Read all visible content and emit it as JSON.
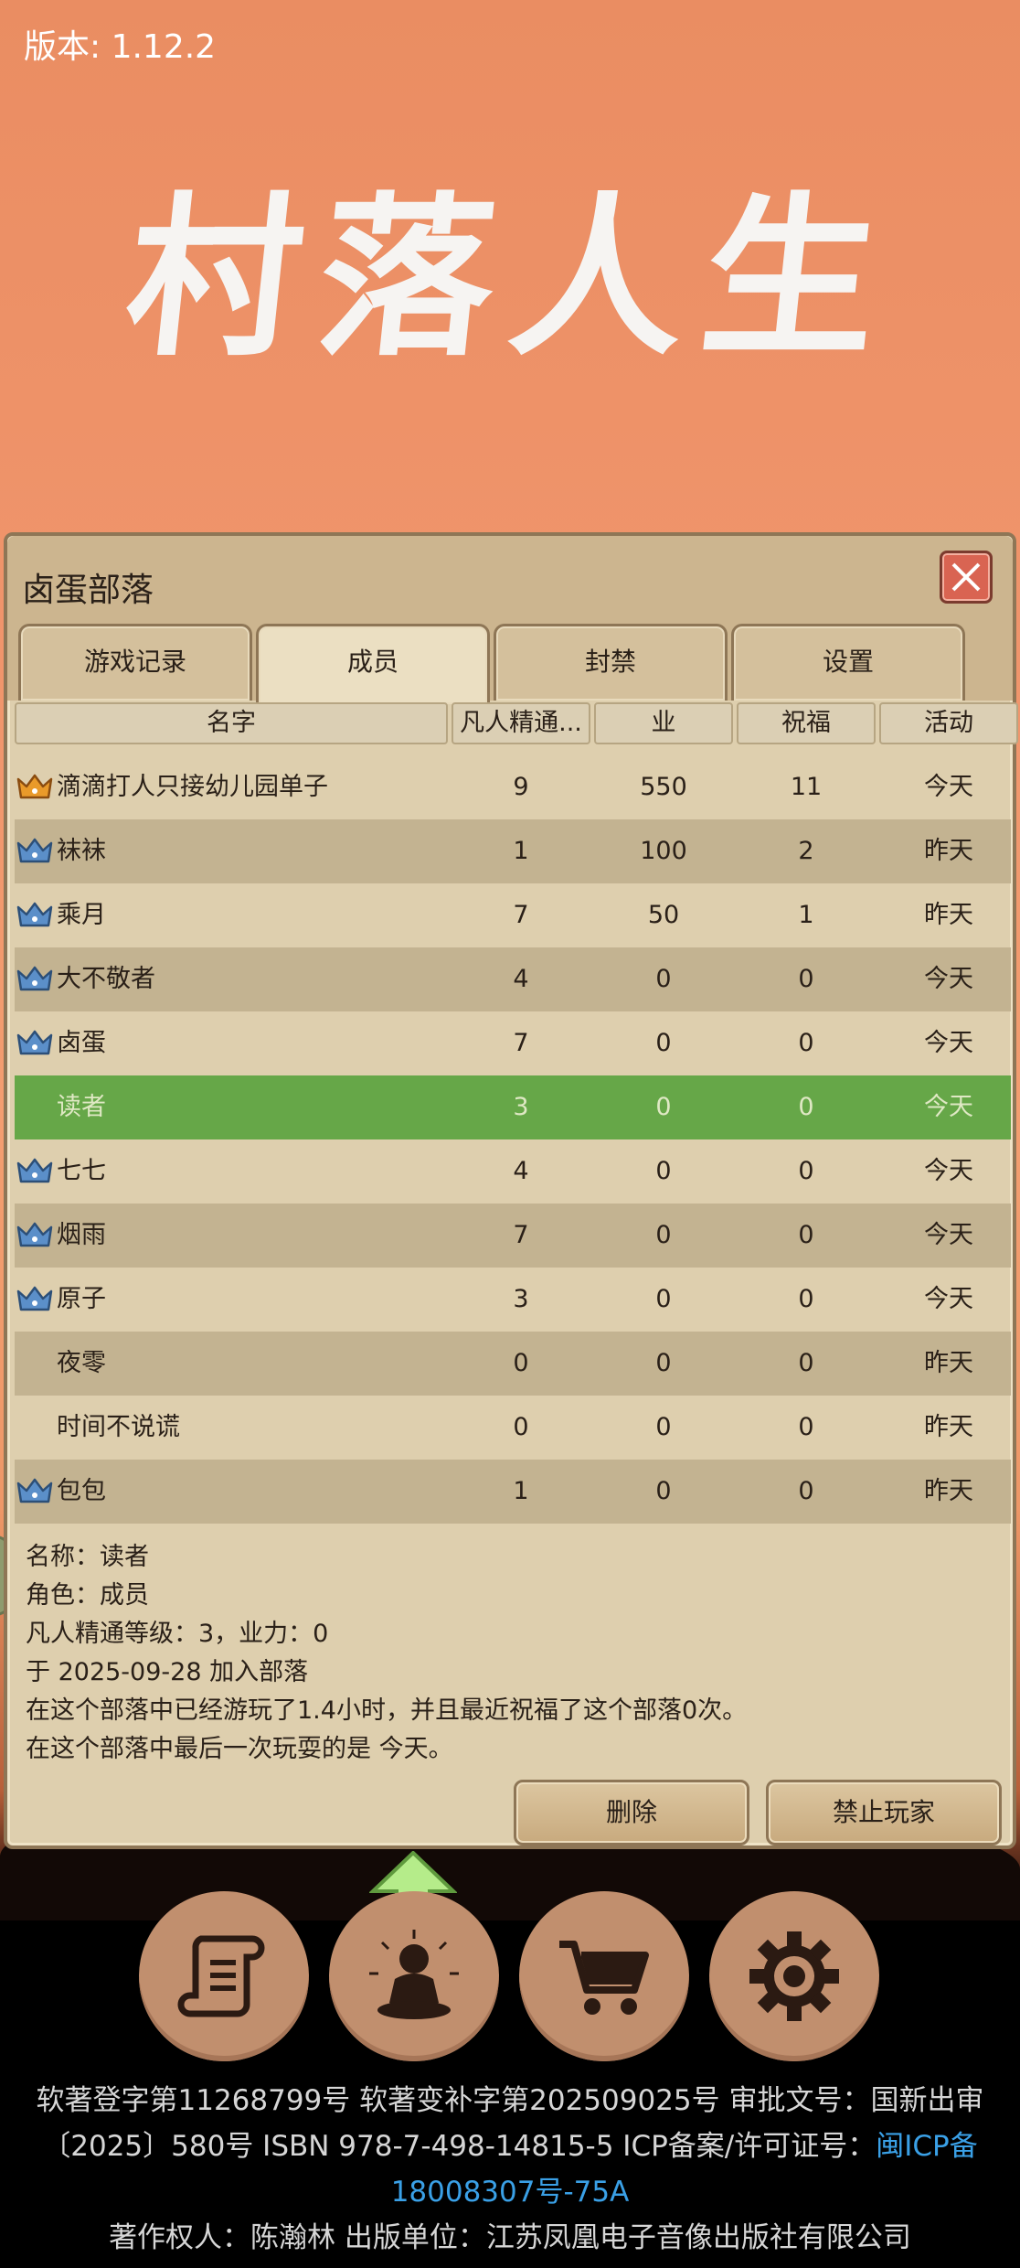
{
  "app": {
    "version": "版本: 1.12.2",
    "logo_text": "村落人生"
  },
  "dialog": {
    "title": "卤蛋部落",
    "tabs": [
      {
        "label": "游戏记录",
        "active": false
      },
      {
        "label": "成员",
        "active": true
      },
      {
        "label": "封禁",
        "active": false
      },
      {
        "label": "设置",
        "active": false
      }
    ],
    "columns": [
      "名字",
      "凡人精通...",
      "业",
      "祝福",
      "活动"
    ],
    "members": [
      {
        "crown": "gold",
        "name": "滴滴打人只接幼儿园单子",
        "mastery": "9",
        "karma": "550",
        "blessing": "11",
        "activity": "今天"
      },
      {
        "crown": "blue",
        "name": "袜袜",
        "mastery": "1",
        "karma": "100",
        "blessing": "2",
        "activity": "昨天"
      },
      {
        "crown": "blue",
        "name": "乘月",
        "mastery": "7",
        "karma": "50",
        "blessing": "1",
        "activity": "昨天"
      },
      {
        "crown": "blue",
        "name": "大不敬者",
        "mastery": "4",
        "karma": "0",
        "blessing": "0",
        "activity": "今天"
      },
      {
        "crown": "blue",
        "name": "卤蛋",
        "mastery": "7",
        "karma": "0",
        "blessing": "0",
        "activity": "今天"
      },
      {
        "crown": "none",
        "name": "读者",
        "mastery": "3",
        "karma": "0",
        "blessing": "0",
        "activity": "今天",
        "selected": true
      },
      {
        "crown": "blue",
        "name": "七七",
        "mastery": "4",
        "karma": "0",
        "blessing": "0",
        "activity": "今天"
      },
      {
        "crown": "blue",
        "name": "烟雨",
        "mastery": "7",
        "karma": "0",
        "blessing": "0",
        "activity": "今天"
      },
      {
        "crown": "blue",
        "name": "原子",
        "mastery": "3",
        "karma": "0",
        "blessing": "0",
        "activity": "今天"
      },
      {
        "crown": "none",
        "name": "夜零",
        "mastery": "0",
        "karma": "0",
        "blessing": "0",
        "activity": "昨天"
      },
      {
        "crown": "none",
        "name": "时间不说谎",
        "mastery": "0",
        "karma": "0",
        "blessing": "0",
        "activity": "昨天"
      },
      {
        "crown": "blue",
        "name": "包包",
        "mastery": "1",
        "karma": "0",
        "blessing": "0",
        "activity": "昨天"
      }
    ],
    "details": [
      "名称：读者",
      "角色：成员",
      "凡人精通等级：3，业力：0",
      "于 2025-09-28 加入部落",
      "在这个部落中已经游玩了1.4小时，并且最近祝福了这个部落0次。",
      "在这个部落中最后一次玩耍的是 今天。"
    ],
    "delete_label": "删除",
    "ban_label": "禁止玩家"
  },
  "nav": {
    "items": [
      "scroll-icon",
      "meditation-icon",
      "cart-icon",
      "gear-icon"
    ]
  },
  "footer": {
    "line1": "软著登字第11268799号 软著变补字第202509025号 审批文号：国新出审",
    "line2_text": "〔2025〕580号 ISBN 978-7-498-14815-5 ICP备案/许可证号：",
    "line2_link": "闽ICP备",
    "line3_link": "18008307号-75A",
    "line4": "著作权人：陈瀚林 出版单位：江苏凤凰电子音像出版社有限公司"
  },
  "colors": {
    "sky": "#f0956c",
    "panel": "#decfae",
    "selected_row": "#66a748",
    "link": "#3aa0e6"
  }
}
